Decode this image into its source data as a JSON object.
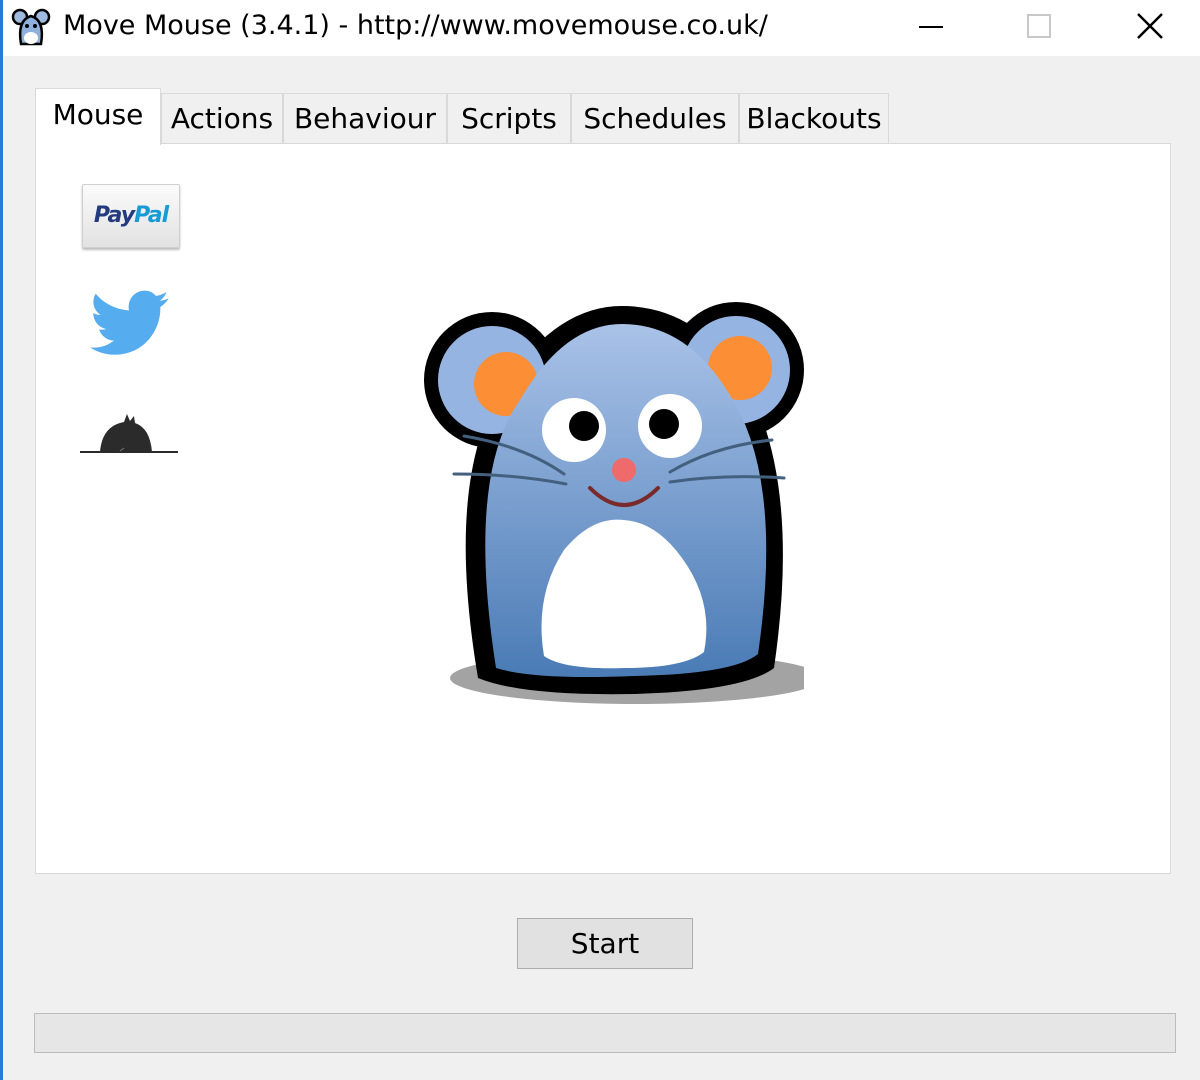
{
  "window": {
    "title": "Move Mouse (3.4.1) - http://www.movemouse.co.uk/",
    "accent_color": "#2b79d6"
  },
  "controls": {
    "minimize_icon": "minimize-icon",
    "maximize_icon": "maximize-icon",
    "close_icon": "close-icon"
  },
  "tabs": [
    {
      "label": "Mouse",
      "active": true
    },
    {
      "label": "Actions",
      "active": false
    },
    {
      "label": "Behaviour",
      "active": false
    },
    {
      "label": "Scripts",
      "active": false
    },
    {
      "label": "Schedules",
      "active": false
    },
    {
      "label": "Blackouts",
      "active": false
    }
  ],
  "mouse_tab": {
    "links": [
      {
        "name": "paypal-donate",
        "icon": "paypal-logo",
        "text_pay": "Pay",
        "text_pal": "Pal"
      },
      {
        "name": "twitter",
        "icon": "twitter-bird-icon",
        "color": "#55acee"
      },
      {
        "name": "mole",
        "icon": "mole-icon"
      }
    ],
    "mascot": {
      "icon": "mouse-mascot",
      "body_color": "#6f9bd0",
      "ear_color": "#fc8e36"
    }
  },
  "start_button": {
    "label": "Start"
  },
  "progress": {
    "value": 0
  }
}
